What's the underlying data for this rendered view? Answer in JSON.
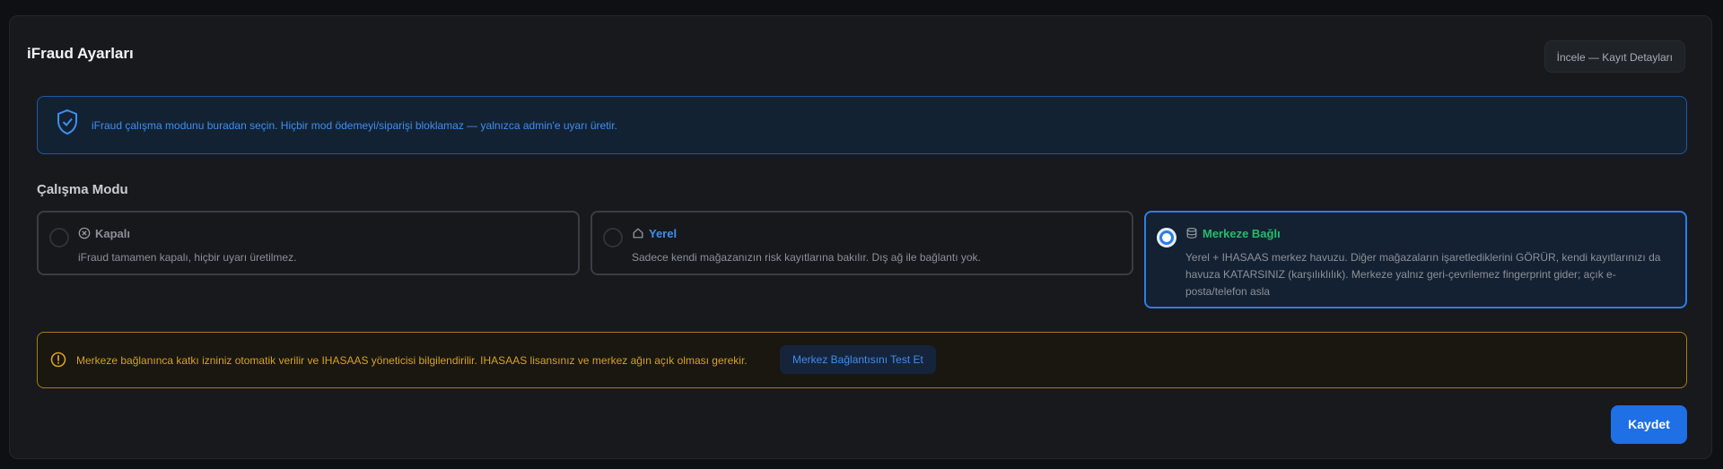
{
  "page": {
    "title": "iFraud Ayarları",
    "top_button": "İncele — Kayıt Detayları"
  },
  "info_banner": {
    "text": "iFraud çalışma modunu buradan seçin. Hiçbir mod ödemeyi/siparişi bloklamaz — yalnızca admin'e uyarı üretir."
  },
  "mode_section": {
    "label": "Çalışma Modu",
    "options": [
      {
        "label": "Kapalı",
        "icon": "x-circle-icon",
        "description": "iFraud tamamen kapalı, hiçbir uyarı üretilmez.",
        "selected": false,
        "color": "#8c9098"
      },
      {
        "label": "Yerel",
        "icon": "home-icon",
        "description": "Sadece kendi mağazanızın risk kayıtlarına bakılır. Dış ağ ile bağlantı yok.",
        "selected": false,
        "color": "#3f8ef0"
      },
      {
        "label": "Merkeze Bağlı",
        "icon": "database-icon",
        "description": "Yerel + IHASAAS merkez havuzu. Diğer mağazaların işaretlediklerini GÖRÜR, kendi kayıtlarınızı da havuza KATARSINIZ (karşılıklılık). Merkeze yalnız geri-çevrilemez fingerprint gider; açık e-posta/telefon asla",
        "selected": true,
        "color": "#1fbf6a"
      }
    ]
  },
  "warning": {
    "text": "Merkeze bağlanınca katkı izniniz otomatik verilir ve IHASAAS yöneticisi bilgilendirilir. IHASAAS lisansınız ve merkez ağın açık olması gerekir.",
    "test_button": "Merkez Bağlantısını Test Et",
    "color": "#d7a120"
  },
  "actions": {
    "save": "Kaydet"
  },
  "colors": {
    "accent": "#1f6fe5",
    "background": "#17191d"
  }
}
